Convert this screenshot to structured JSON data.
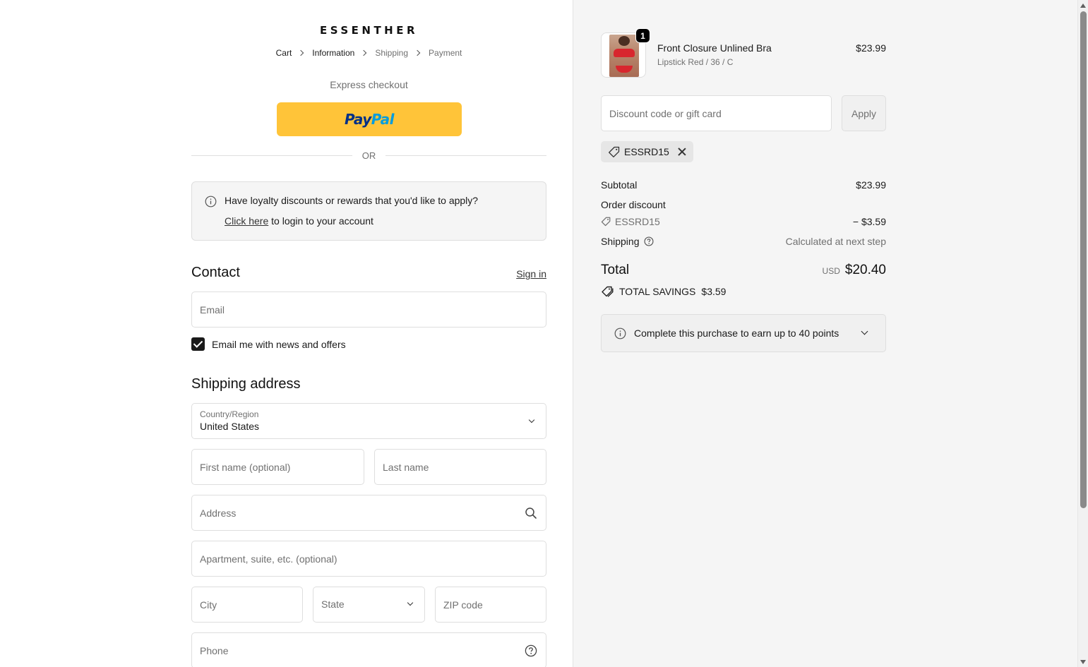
{
  "brand": {
    "logo_text": "ESSENTHER"
  },
  "breadcrumb": {
    "items": [
      {
        "label": "Cart",
        "state": "done"
      },
      {
        "label": "Information",
        "state": "current"
      },
      {
        "label": "Shipping",
        "state": "upcoming"
      },
      {
        "label": "Payment",
        "state": "upcoming"
      }
    ]
  },
  "express": {
    "heading": "Express checkout",
    "paypal_pay": "Pay",
    "paypal_pal": "Pal",
    "paypal_color": "#ffc439",
    "divider_label": "OR"
  },
  "loyalty": {
    "question": "Have loyalty discounts or rewards that you'd like to apply?",
    "link_text": "Click here",
    "link_suffix": " to login to your account"
  },
  "contact": {
    "heading": "Contact",
    "sign_in": "Sign in",
    "email_placeholder": "Email",
    "newsletter_label": "Email me with news and offers",
    "newsletter_checked": true
  },
  "shipping": {
    "heading": "Shipping address",
    "country_label": "Country/Region",
    "country_value": "United States",
    "first_name_placeholder": "First name (optional)",
    "last_name_placeholder": "Last name",
    "address_placeholder": "Address",
    "apartment_placeholder": "Apartment, suite, etc. (optional)",
    "city_placeholder": "City",
    "state_placeholder": "State",
    "zip_placeholder": "ZIP code",
    "phone_placeholder": "Phone"
  },
  "cart": {
    "item": {
      "quantity": "1",
      "name": "Front Closure Unlined Bra",
      "variant": "Lipstick Red / 36 / C",
      "price": "$23.99"
    },
    "discount_placeholder": "Discount code or gift card",
    "apply_label": "Apply",
    "applied_code": "ESSRD15"
  },
  "summary": {
    "subtotal_label": "Subtotal",
    "subtotal_value": "$23.99",
    "order_discount_label": "Order discount",
    "discount_code": "ESSRD15",
    "discount_value": "− $3.59",
    "shipping_label": "Shipping",
    "shipping_value": "Calculated at next step",
    "total_label": "Total",
    "currency": "USD",
    "total_value": "$20.40",
    "savings_label": "TOTAL SAVINGS",
    "savings_value": "$3.59"
  },
  "points": {
    "text": "Complete this purchase to earn up to 40 points"
  },
  "icons": {
    "info": "info-circle-icon",
    "search": "search-icon",
    "help": "question-circle-icon",
    "tag": "tag-icon",
    "close": "close-icon",
    "chevron": "chevron-down-icon"
  }
}
